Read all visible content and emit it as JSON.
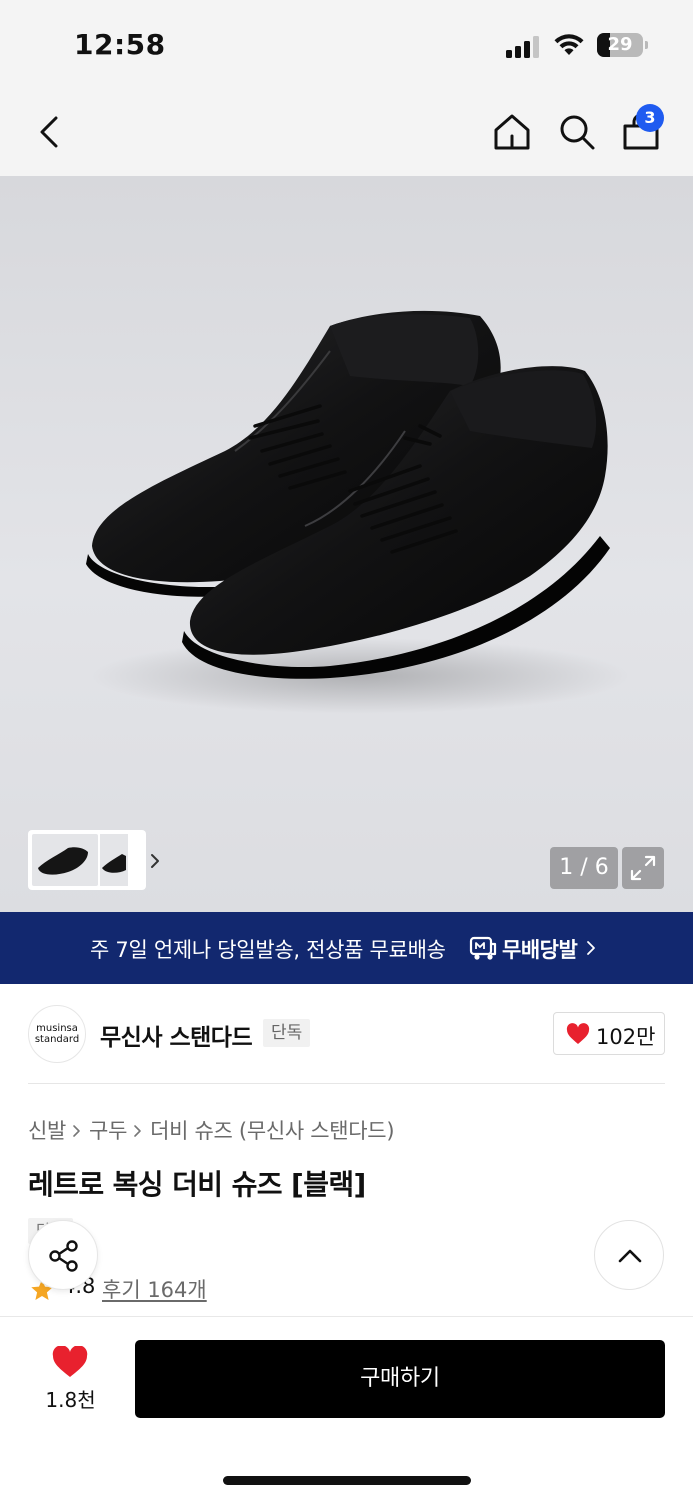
{
  "status_bar": {
    "time": "12:58",
    "battery_level": "29",
    "icons": [
      "cellular-signal-icon",
      "wifi-icon",
      "battery-icon"
    ]
  },
  "header": {
    "icons": [
      "back-chevron-icon",
      "home-icon",
      "search-icon",
      "cart-icon"
    ],
    "cart_badge": "3"
  },
  "gallery": {
    "current_page": "1",
    "total_pages": "6",
    "counter": "1 / 6",
    "icons": [
      "expand-icon",
      "chevron-right-icon"
    ]
  },
  "promo_banner": {
    "text": "주 7일 언제나 당일발송, 전상품 무료배송",
    "brand": "무배당발",
    "background": "#12286f"
  },
  "brand": {
    "logo_line1": "musinsa",
    "logo_line2": "standard",
    "name": "무신사 스탠다드",
    "tag": "단독",
    "like_count": "102만"
  },
  "product": {
    "breadcrumb": [
      "신발",
      "구두",
      "더비 슈즈 (무신사 스탠다드)"
    ],
    "title": "레트로 복싱 더비 슈즈 [블랙]",
    "tag": "단독",
    "rating": "4.8",
    "reviews": "후기 164개"
  },
  "bottom_bar": {
    "wish_count": "1.8천",
    "buy_label": "구매하기",
    "heart_color": "#e8212e"
  },
  "colors": {
    "accent_blue": "#1f5bf0",
    "star": "#f5a623"
  }
}
